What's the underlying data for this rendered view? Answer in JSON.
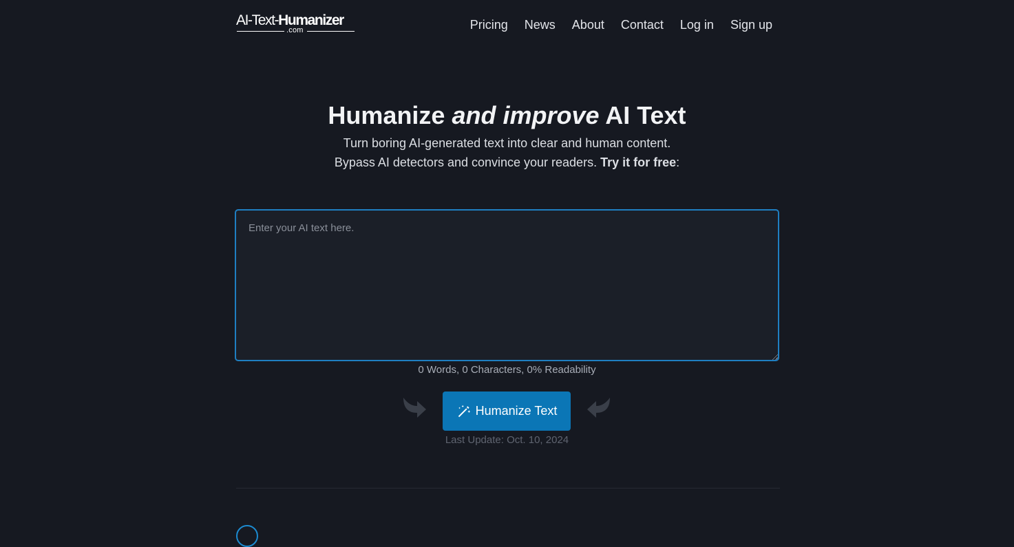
{
  "header": {
    "logo": {
      "part1": "AI-Text-",
      "part2": "Humanizer",
      "suffix": ".com"
    },
    "nav": [
      "Pricing",
      "News",
      "About",
      "Contact",
      "Log in",
      "Sign up"
    ]
  },
  "hero": {
    "title_start": "Humanize ",
    "title_emphasis": "and improve",
    "title_end": " AI Text",
    "line1": "Turn boring AI-generated text into clear and human content.",
    "line2_start": "Bypass AI detectors and convince your readers. ",
    "line2_bold": "Try it for free",
    "line2_end": ":"
  },
  "editor": {
    "placeholder": "Enter your AI text here.",
    "value": ""
  },
  "stats": "0 Words, 0 Characters, 0% Readability",
  "action": {
    "button_label": "Humanize Text",
    "icon": "magic-wand-icon"
  },
  "last_update": "Last Update: Oct. 10, 2024",
  "colors": {
    "background": "#161921",
    "accent": "#0b76b6",
    "editor_border": "#1f7fc2",
    "muted_text": "#a8adb7"
  }
}
